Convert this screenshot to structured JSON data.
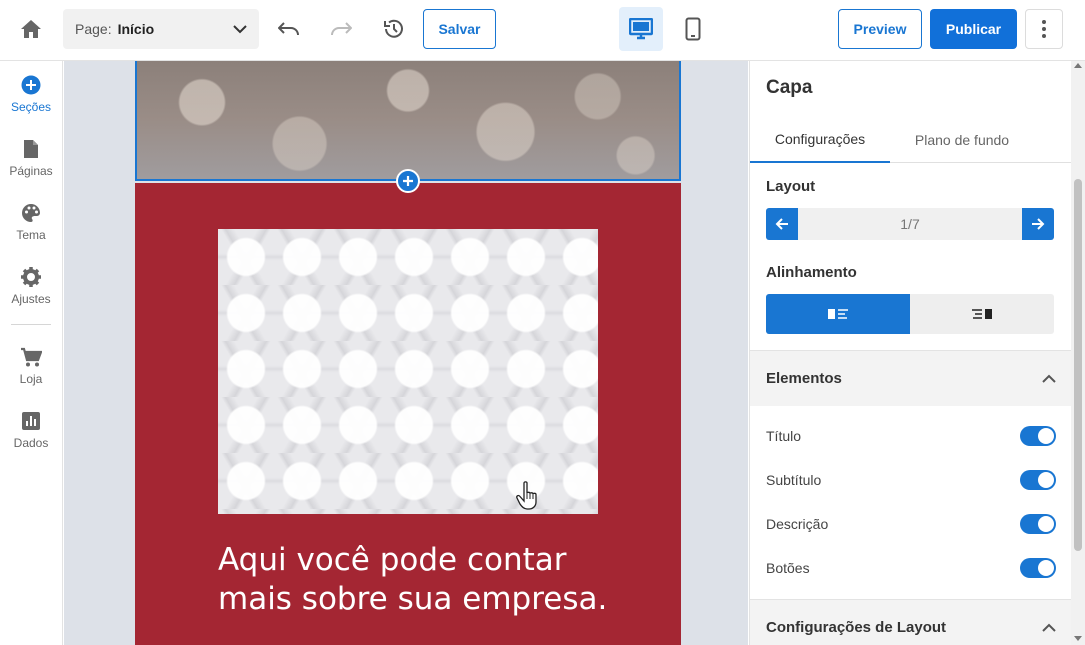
{
  "topbar": {
    "page_label": "Page:",
    "page_value": "Início",
    "save_label": "Salvar",
    "preview_label": "Preview",
    "publish_label": "Publicar"
  },
  "leftnav": {
    "items": [
      {
        "label": "Seções",
        "icon": "add-circle-icon"
      },
      {
        "label": "Páginas",
        "icon": "page-icon"
      },
      {
        "label": "Tema",
        "icon": "palette-icon"
      },
      {
        "label": "Ajustes",
        "icon": "gear-icon"
      },
      {
        "label": "Loja",
        "icon": "cart-icon"
      },
      {
        "label": "Dados",
        "icon": "bar-chart-icon"
      }
    ]
  },
  "canvas": {
    "hero_title": "Aqui você pode contar mais sobre sua empresa."
  },
  "panel": {
    "title": "Capa",
    "tabs": [
      {
        "label": "Configurações",
        "active": true
      },
      {
        "label": "Plano de fundo",
        "active": false
      }
    ],
    "layout_label": "Layout",
    "layout_count": "1/7",
    "alignment_label": "Alinhamento",
    "elements_group": "Elementos",
    "toggles": [
      {
        "label": "Título",
        "on": true
      },
      {
        "label": "Subtítulo",
        "on": true
      },
      {
        "label": "Descrição",
        "on": true
      },
      {
        "label": "Botões",
        "on": true
      }
    ],
    "layout_settings_group": "Configurações de Layout"
  },
  "colors": {
    "accent": "#1976d2",
    "hero_background": "#a42633",
    "canvas_background": "#dde1e8"
  }
}
